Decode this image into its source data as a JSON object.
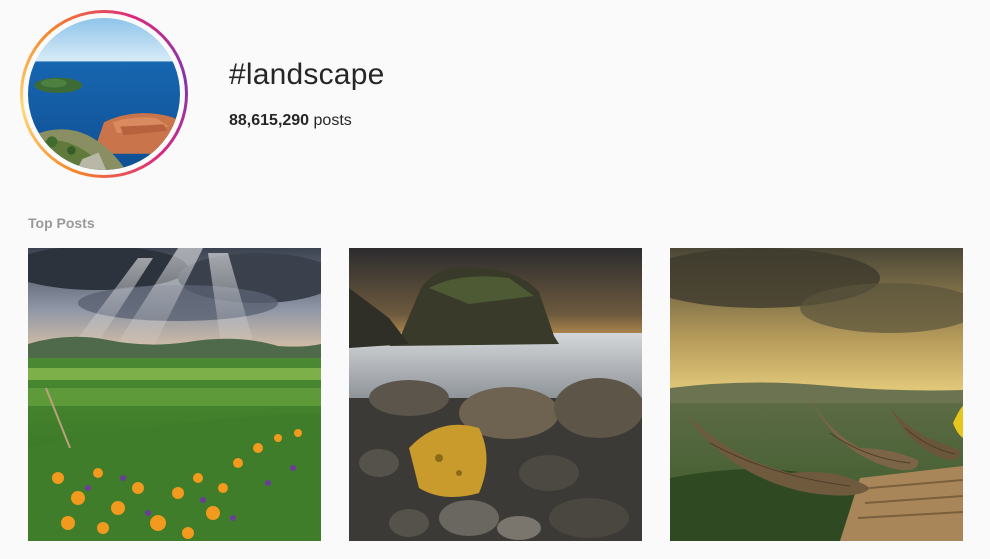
{
  "header": {
    "hashtag": "#landscape",
    "post_count": "88,615,290",
    "post_count_suffix": " posts",
    "avatar_icon": "coastal-city-photo"
  },
  "sections": {
    "top_posts_label": "Top Posts"
  },
  "posts": [
    {
      "image": "wildflower-meadow-photo"
    },
    {
      "image": "rocky-coast-longexposure-photo"
    },
    {
      "image": "woven-boats-valley-sunset-photo"
    }
  ],
  "colors": {
    "background": "#fafafa",
    "text": "#262626",
    "muted": "#999999",
    "ring_start": "#f58529",
    "ring_end": "#dd2a7b"
  }
}
